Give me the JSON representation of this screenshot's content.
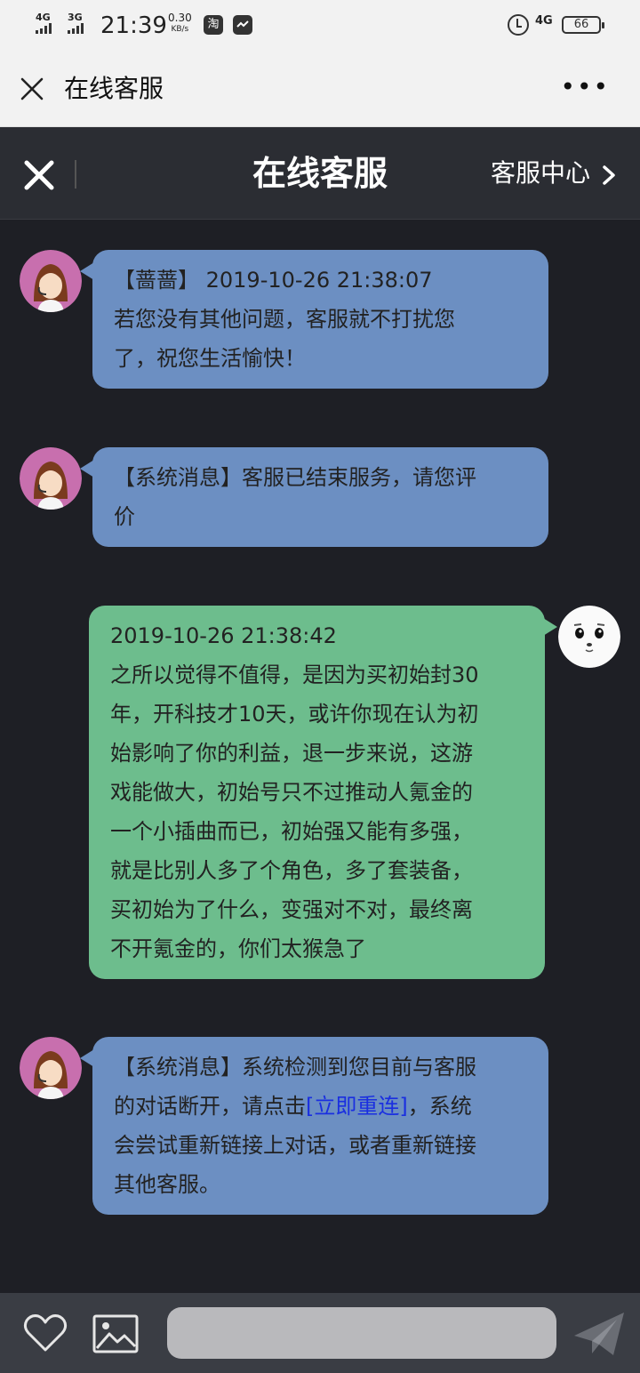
{
  "status_bar": {
    "signal1": "4G",
    "signal2": "3G",
    "time": "21:39",
    "speed_value": "0.30",
    "speed_unit": "KB/s",
    "app1_glyph": "淘",
    "net": "4G",
    "battery": "66"
  },
  "wx_bar": {
    "title": "在线客服",
    "more": "•••"
  },
  "header": {
    "title": "在线客服",
    "center_link": "客服中心"
  },
  "messages": [
    {
      "side": "agent",
      "lines": [
        "【蔷蔷】 2019-10-26 21:38:07",
        "若您没有其他问题，客服就不打扰您",
        "了，祝您生活愉快！"
      ]
    },
    {
      "side": "agent",
      "lines": [
        "【系统消息】客服已结束服务，请您评",
        "价"
      ]
    },
    {
      "side": "user",
      "lines": [
        "2019-10-26 21:38:42",
        "之所以觉得不值得，是因为买初始封30",
        "年，开科技才10天，或许你现在认为初",
        "始影响了你的利益，退一步来说，这游",
        "戏能做大，初始号只不过推动人氪金的",
        "一个小插曲而已，初始强又能有多强，",
        "就是比别人多了个角色，多了套装备，",
        "买初始为了什么，变强对不对，最终离",
        "不开氪金的，你们太猴急了"
      ]
    },
    {
      "side": "agent",
      "line1": "【系统消息】系统检测到您目前与客服",
      "line2_before": "的对话断开，请点击",
      "line2_link": "[立即重连]",
      "line2_after": "，系统",
      "line3": "会尝试重新链接上对话，或者重新链接",
      "line4": "其他客服。"
    }
  ],
  "colors": {
    "agent_bubble": "#6c8fc2",
    "user_bubble": "#6dbd8d",
    "chat_bg": "#1e1f25",
    "link": "#1a2fe0"
  },
  "icons": {
    "close": "close-icon",
    "more": "more-icon",
    "chevron": "chevron-right-icon",
    "heart": "heart-icon",
    "image": "image-icon",
    "send": "send-icon"
  }
}
